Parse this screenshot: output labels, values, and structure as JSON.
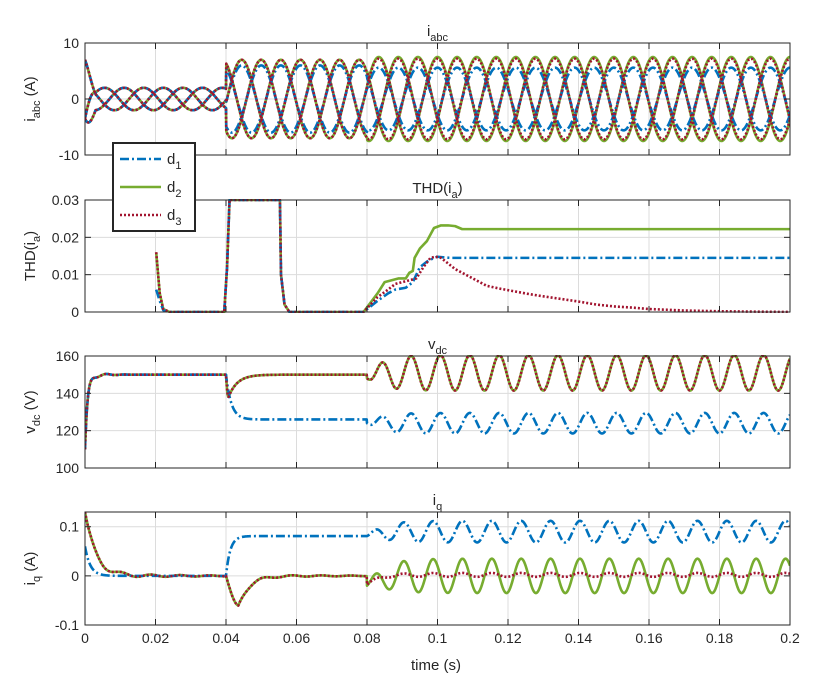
{
  "figure": {
    "xlabel": "time (s)"
  },
  "legend": {
    "entries": [
      {
        "name": "d",
        "sub": "1",
        "color": "#0072BD",
        "dash": "dashdot"
      },
      {
        "name": "d",
        "sub": "2",
        "color": "#77AC30",
        "dash": "solid"
      },
      {
        "name": "d",
        "sub": "3",
        "color": "#A2142F",
        "dash": "dotted"
      }
    ]
  },
  "chart_data": [
    {
      "type": "line",
      "title": "i",
      "title_sub": "abc",
      "ylabel": "i",
      "ylabel_sub": "abc",
      "ylabel_unit": " (A)",
      "xlim": [
        0,
        0.2
      ],
      "ylim": [
        -10,
        10
      ],
      "grid": true,
      "xticks": [
        0,
        0.02,
        0.04,
        0.06,
        0.08,
        0.1,
        0.12,
        0.14,
        0.16,
        0.18,
        0.2
      ],
      "yticks": [
        -10,
        0,
        10
      ],
      "ytick_labels": [
        "-10",
        "0",
        "10"
      ],
      "model": "three_phase_currents",
      "series": [
        {
          "name": "d1",
          "segments": [
            {
              "t": [
                0,
                0.04
              ],
              "amp": 2,
              "freq": 60
            },
            {
              "t": [
                0.04,
                0.08
              ],
              "amp": 6,
              "freq": 60
            },
            {
              "t": [
                0.08,
                0.2
              ],
              "amp": 5.6,
              "freq": 60
            }
          ]
        },
        {
          "name": "d2",
          "segments": [
            {
              "t": [
                0,
                0.04
              ],
              "amp": 2,
              "freq": 60
            },
            {
              "t": [
                0.04,
                0.08
              ],
              "amp": 7,
              "freq": 60
            },
            {
              "t": [
                0.08,
                0.2
              ],
              "amp": 7.5,
              "freq": 60
            }
          ]
        },
        {
          "name": "d3",
          "segments": [
            {
              "t": [
                0,
                0.04
              ],
              "amp": 2,
              "freq": 60
            },
            {
              "t": [
                0.04,
                0.08
              ],
              "amp": 7,
              "freq": 60
            },
            {
              "t": [
                0.08,
                0.2
              ],
              "amp": 7.2,
              "freq": 60
            }
          ]
        }
      ]
    },
    {
      "type": "line",
      "title": "THD(i",
      "title_sub": "a",
      "title_tail": ")",
      "ylabel": "THD(i",
      "ylabel_sub": "a",
      "ylabel_unit": ")",
      "xlim": [
        0,
        0.2
      ],
      "ylim": [
        0,
        0.03
      ],
      "grid": true,
      "xticks": [
        0,
        0.02,
        0.04,
        0.06,
        0.08,
        0.1,
        0.12,
        0.14,
        0.16,
        0.18,
        0.2
      ],
      "yticks": [
        0,
        0.01,
        0.02,
        0.03
      ],
      "ytick_labels": [
        "0",
        "0.01",
        "0.02",
        "0.03"
      ],
      "series": [
        {
          "name": "d1",
          "x": [
            0.0202,
            0.0212,
            0.0222,
            0.024,
            0.0395,
            0.0403,
            0.041,
            0.0553,
            0.0556,
            0.0566,
            0.058,
            0.079,
            0.083,
            0.086,
            0.088,
            0.091,
            0.093,
            0.095,
            0.097,
            0.099,
            0.1,
            0.102,
            0.104,
            0.106,
            0.2
          ],
          "y": [
            0.006,
            0.003,
            0.0005,
            0,
            0,
            0.012,
            0.03,
            0.03,
            0.01,
            0.002,
            0,
            0,
            0.003,
            0.005,
            0.006,
            0.0065,
            0.008,
            0.012,
            0.0135,
            0.0145,
            0.0148,
            0.0146,
            0.0145,
            0.0145,
            0.0145
          ]
        },
        {
          "name": "d2",
          "x": [
            0.0202,
            0.0212,
            0.0222,
            0.024,
            0.0395,
            0.0403,
            0.041,
            0.0553,
            0.0556,
            0.0566,
            0.058,
            0.079,
            0.083,
            0.085,
            0.087,
            0.089,
            0.091,
            0.092,
            0.093,
            0.0935,
            0.095,
            0.097,
            0.099,
            0.101,
            0.103,
            0.105,
            0.107,
            0.2
          ],
          "y": [
            0.016,
            0.005,
            0.0008,
            0,
            0,
            0.012,
            0.03,
            0.03,
            0.01,
            0.002,
            0,
            0,
            0.005,
            0.008,
            0.0085,
            0.009,
            0.009,
            0.0105,
            0.011,
            0.0145,
            0.017,
            0.019,
            0.0225,
            0.0232,
            0.0232,
            0.023,
            0.0222,
            0.0222
          ]
        },
        {
          "name": "d3",
          "x": [
            0.0202,
            0.0212,
            0.0222,
            0.024,
            0.0395,
            0.0403,
            0.041,
            0.0553,
            0.0556,
            0.0566,
            0.058,
            0.079,
            0.083,
            0.086,
            0.088,
            0.09,
            0.092,
            0.094,
            0.096,
            0.098,
            0.0995,
            0.101,
            0.103,
            0.105,
            0.107,
            0.109,
            0.111,
            0.114,
            0.118,
            0.122,
            0.126,
            0.13,
            0.135,
            0.14,
            0.145,
            0.15,
            0.155,
            0.16,
            0.165,
            0.17,
            0.175,
            0.18,
            0.19,
            0.2
          ],
          "y": [
            0.016,
            0.005,
            0.0008,
            0,
            0,
            0.012,
            0.03,
            0.03,
            0.01,
            0.002,
            0,
            0,
            0.004,
            0.006,
            0.0075,
            0.008,
            0.0085,
            0.009,
            0.012,
            0.0145,
            0.0148,
            0.0145,
            0.013,
            0.0115,
            0.0105,
            0.0095,
            0.0085,
            0.007,
            0.0062,
            0.0055,
            0.0048,
            0.0042,
            0.0035,
            0.0028,
            0.002,
            0.0015,
            0.0012,
            0.0008,
            0.0006,
            0.0004,
            0.0003,
            0.0002,
            0.0001,
            0
          ]
        }
      ]
    },
    {
      "type": "line",
      "title": "v",
      "title_sub": "dc",
      "ylabel": "v",
      "ylabel_sub": "dc",
      "ylabel_unit": " (V)",
      "xlim": [
        0,
        0.2
      ],
      "ylim": [
        100,
        160
      ],
      "grid": true,
      "xticks": [
        0,
        0.02,
        0.04,
        0.06,
        0.08,
        0.1,
        0.12,
        0.14,
        0.16,
        0.18,
        0.2
      ],
      "yticks": [
        100,
        120,
        140,
        160
      ],
      "ytick_labels": [
        "100",
        "120",
        "140",
        "160"
      ],
      "model": "dc_link",
      "series": [
        {
          "name": "d1",
          "start": 110,
          "level1": 150,
          "level2": 126,
          "level3_mean": 124,
          "ripple": 5.5,
          "freq": 120
        },
        {
          "name": "d2",
          "start": 110,
          "level1": 150,
          "level2": 150,
          "level3_mean": 151,
          "ripple": 9.5,
          "freq": 120
        },
        {
          "name": "d3",
          "start": 110,
          "level1": 150,
          "level2": 150,
          "level3_mean": 151,
          "ripple": 9.5,
          "freq": 120
        }
      ]
    },
    {
      "type": "line",
      "title": "i",
      "title_sub": "q",
      "ylabel": "i",
      "ylabel_sub": "q",
      "ylabel_unit": " (A)",
      "xlim": [
        0,
        0.2
      ],
      "ylim": [
        -0.1,
        0.13
      ],
      "grid": true,
      "xticks": [
        0,
        0.02,
        0.04,
        0.06,
        0.08,
        0.1,
        0.12,
        0.14,
        0.16,
        0.18,
        0.2
      ],
      "xtick_labels": [
        "0",
        "0.02",
        "0.04",
        "0.06",
        "0.08",
        "0.1",
        "0.12",
        "0.14",
        "0.16",
        "0.18",
        "0.2"
      ],
      "yticks": [
        -0.1,
        0,
        0.1
      ],
      "ytick_labels": [
        "-0.1",
        "0",
        "0.1"
      ],
      "model": "iq",
      "series": [
        {
          "name": "d1",
          "start": 0.06,
          "level_mid": 0.081,
          "mean3": 0.09,
          "osc3": 0.022,
          "freq": 120
        },
        {
          "name": "d2",
          "start": 0.13,
          "level_mid": 0,
          "mean3": 0,
          "osc3": 0.035,
          "freq": 120
        },
        {
          "name": "d3",
          "start": 0.13,
          "level_mid": 0,
          "mean3": 0.002,
          "osc3": 0.004,
          "freq": 120
        }
      ]
    }
  ]
}
